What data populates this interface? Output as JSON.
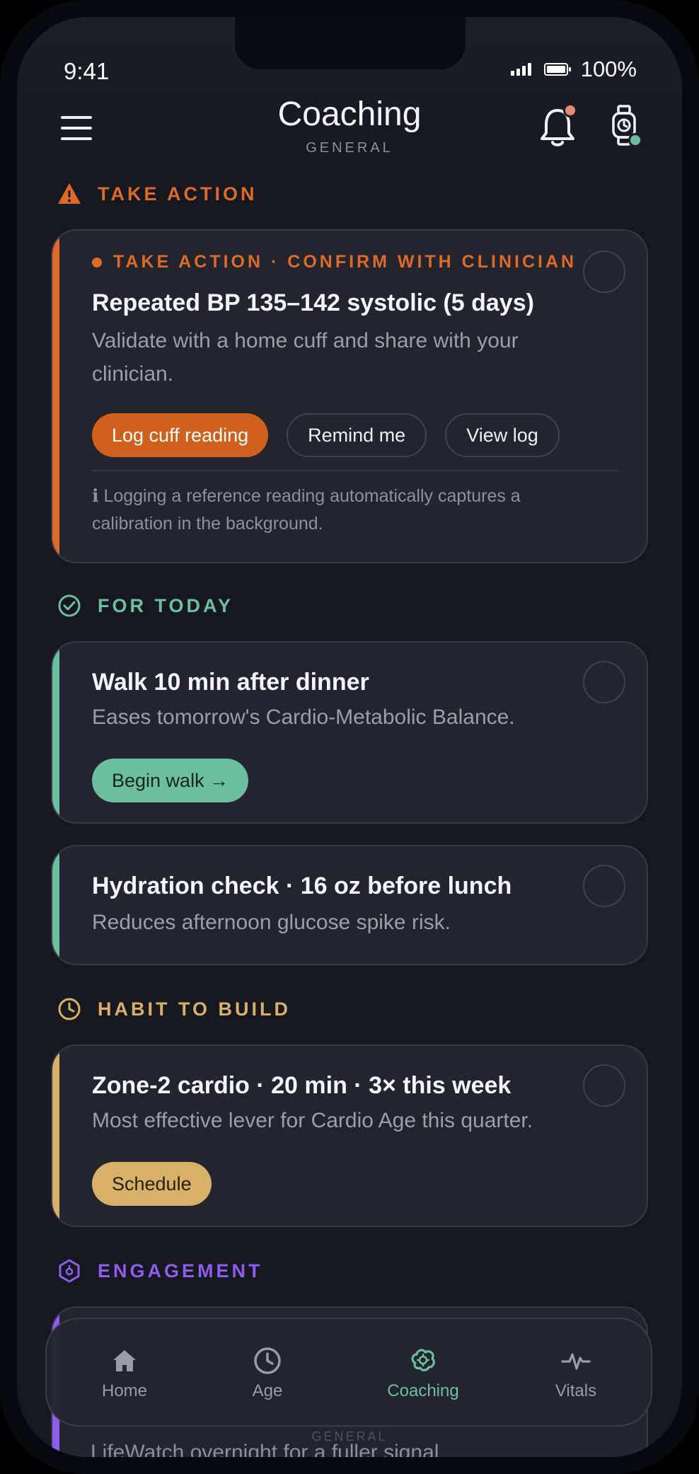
{
  "status": {
    "time": "9:41",
    "battery": "100%"
  },
  "header": {
    "title": "Coaching",
    "subtitle": "GENERAL",
    "menu_icon": "hamburger-menu-icon",
    "notification_icon": "bell-icon",
    "device_icon": "smartwatch-icon"
  },
  "sections": {
    "take_action": {
      "label": "TAKE ACTION",
      "icon": "warning-triangle-icon",
      "color": "#dc6a28"
    },
    "for_today": {
      "label": "FOR TODAY",
      "icon": "check-circle-icon",
      "color": "#6bbf9f"
    },
    "habit": {
      "label": "HABIT TO BUILD",
      "icon": "clock-icon",
      "color": "#d7b06a"
    },
    "engagement": {
      "label": "ENGAGEMENT",
      "icon": "hexagon-badge-icon",
      "color": "#8f5cf0"
    }
  },
  "cards": {
    "bp": {
      "tag": "TAKE ACTION · CONFIRM WITH CLINICIAN",
      "title": "Repeated BP 135–142 systolic (5 days)",
      "desc": "Validate with a home cuff and share with your clinician.",
      "primary": "Log cuff reading",
      "secondary": "Remind me",
      "tertiary": "View log",
      "note": "ℹ Logging a reference reading automatically captures a calibration in the background."
    },
    "walk": {
      "title": "Walk 10 min after dinner",
      "desc": "Eases tomorrow's Cardio-Metabolic Balance.",
      "button": "Begin walk →"
    },
    "hydration": {
      "title": "Hydration check · 16 oz before lunch",
      "desc": "Reduces afternoon glucose spike risk."
    },
    "zone2": {
      "title": "Zone-2 cardio · 20 min · 3× this week",
      "desc": "Most effective lever for Cardio Age this quarter.",
      "button": "Schedule"
    },
    "engagement_peek": {
      "text": "LifeWatch overnight for a fuller signal"
    }
  },
  "tabbar": {
    "tabs": [
      {
        "label": "Home",
        "icon": "home-icon"
      },
      {
        "label": "Age",
        "icon": "clock-icon"
      },
      {
        "label": "Coaching",
        "icon": "brain-icon",
        "active": true
      },
      {
        "label": "Vitals",
        "icon": "pulse-icon"
      }
    ],
    "peek_label": "GENERAL"
  }
}
